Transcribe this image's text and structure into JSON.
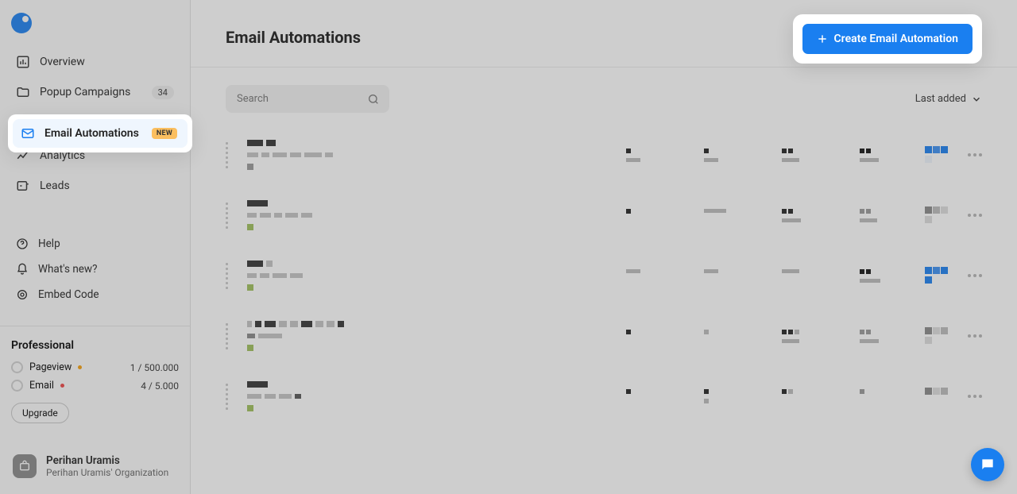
{
  "page": {
    "title": "Email Automations"
  },
  "buttons": {
    "create": "Create Email Automation",
    "upgrade": "Upgrade"
  },
  "search": {
    "placeholder": "Search"
  },
  "sort": {
    "label": "Last added"
  },
  "sidebar": {
    "nav": [
      {
        "label": "Overview"
      },
      {
        "label": "Popup Campaigns",
        "badge": "34"
      },
      {
        "label": "Email Automations",
        "new": "NEW"
      },
      {
        "label": "Analytics"
      },
      {
        "label": "Leads"
      }
    ],
    "secondary": [
      {
        "label": "Help"
      },
      {
        "label": "What's new?"
      },
      {
        "label": "Embed Code"
      }
    ]
  },
  "plan": {
    "name": "Professional",
    "rows": [
      {
        "label": "Pageview",
        "count": "1 / 500.000",
        "dot": "orange"
      },
      {
        "label": "Email",
        "count": "4 / 5.000",
        "dot": "red"
      }
    ]
  },
  "user": {
    "name": "Perihan Uramis",
    "org": "Perihan Uramis' Organization"
  }
}
